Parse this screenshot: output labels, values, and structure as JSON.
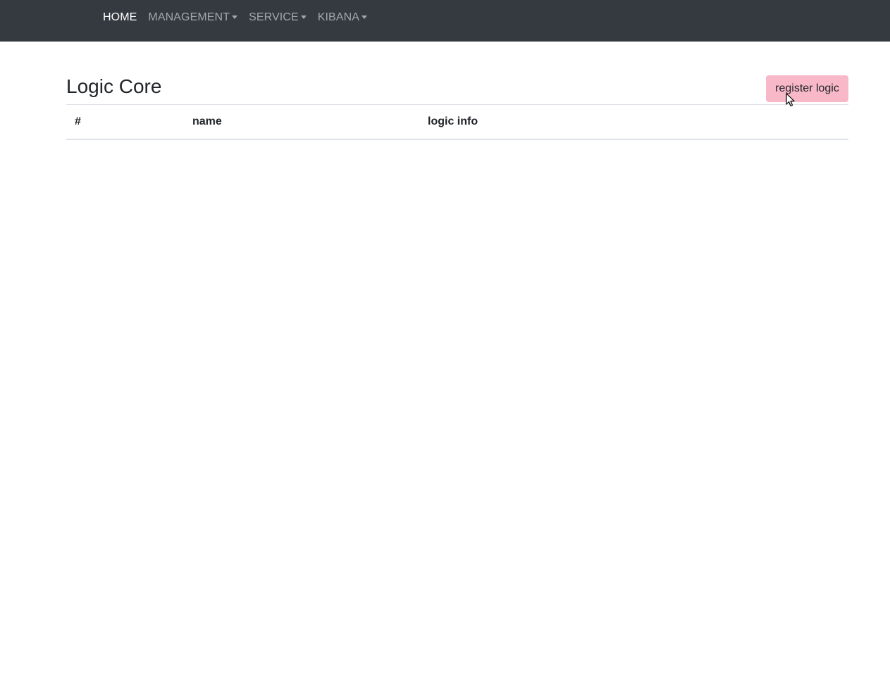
{
  "navbar": {
    "items": [
      {
        "label": "HOME",
        "active": true,
        "dropdown": false
      },
      {
        "label": "MANAGEMENT",
        "active": false,
        "dropdown": true
      },
      {
        "label": "SERVICE",
        "active": false,
        "dropdown": true
      },
      {
        "label": "KIBANA",
        "active": false,
        "dropdown": true
      }
    ],
    "background": "#343a40"
  },
  "page": {
    "title": "Logic Core",
    "register_button": "register logic",
    "register_button_color": "#f8b8c8"
  },
  "table": {
    "columns": [
      "#",
      "name",
      "logic info"
    ],
    "rows": []
  },
  "cursor_icon": "arrow-pointer-icon"
}
